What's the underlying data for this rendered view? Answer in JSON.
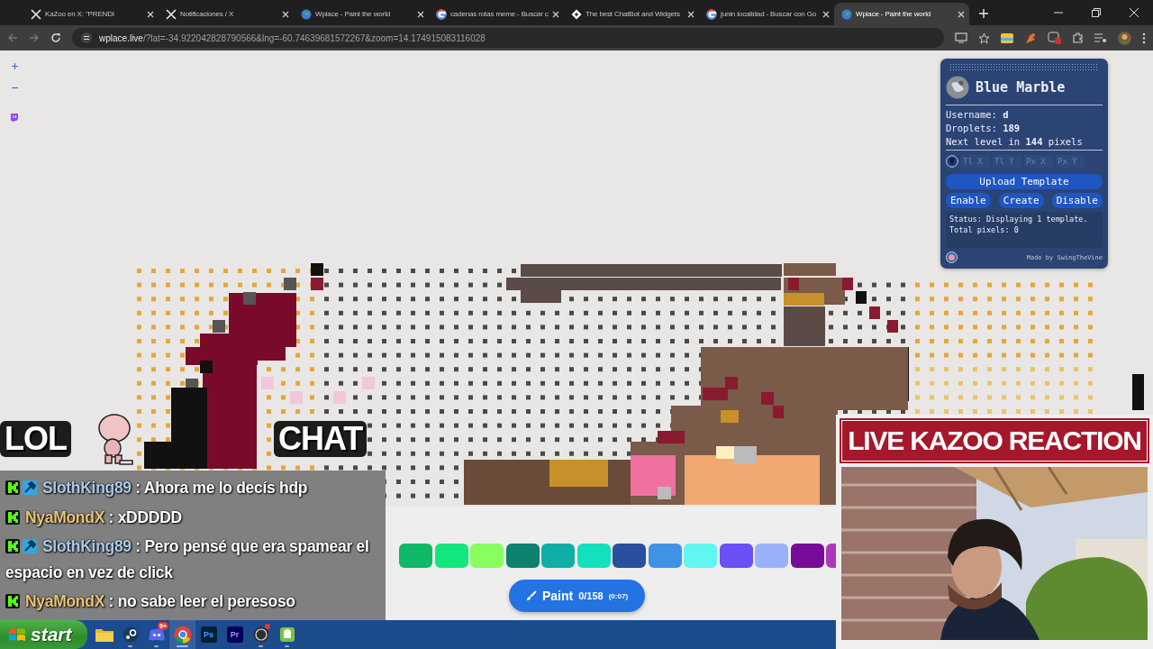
{
  "browser": {
    "tabs": [
      {
        "kind": "x",
        "title": "KaZoo en X: \"PRENDI",
        "selected": false
      },
      {
        "kind": "x",
        "title": "Notificaciones / X",
        "selected": false
      },
      {
        "kind": "globe",
        "title": "Wplace - Paint the world",
        "selected": false
      },
      {
        "kind": "google",
        "title": "cadenas rotas meme - Buscar c",
        "selected": false
      },
      {
        "kind": "bot",
        "title": "The best ChatBot and Widgets",
        "selected": false
      },
      {
        "kind": "google",
        "title": "junin localidad - Buscar con Go",
        "selected": false
      },
      {
        "kind": "globe",
        "title": "Wplace - Paint the world",
        "selected": true
      }
    ],
    "address": {
      "host": "wplace.live",
      "path": "/?lat=-34.922042828790566&lng=-60.74639681572267&zoom=14.174915083116028"
    }
  },
  "panel": {
    "title": "Blue Marble",
    "info": [
      "Username: **d**",
      "Droplets: **189**",
      "Next level in **144** pixels"
    ],
    "coords": [
      {
        "placeholder": "Tl X"
      },
      {
        "placeholder": "Tl Y"
      },
      {
        "placeholder": "Px X"
      },
      {
        "placeholder": "Px Y"
      }
    ],
    "upload": "Upload Template",
    "actions": [
      "Enable",
      "Create",
      "Disable"
    ],
    "status": "Status: Displaying 1 template.\nTotal pixels: 0",
    "footer": "Made by SwingTheVine"
  },
  "palette": {
    "colors": [
      {
        "color": "#0eb968"
      },
      {
        "color": "#13e67b"
      },
      {
        "color": "#87ff5e"
      },
      {
        "color": "#0c816e"
      },
      {
        "color": "#10aea6"
      },
      {
        "color": "#13e1be"
      },
      {
        "color": "#28509e"
      },
      {
        "color": "#4093e4"
      },
      {
        "color": "#60f7f2"
      },
      {
        "color": "#6b50f6"
      },
      {
        "color": "#99b1fb"
      },
      {
        "color": "#780c99"
      },
      {
        "color": "#aa38b9"
      }
    ]
  },
  "paint_button": {
    "label": "Paint",
    "count": "0/158",
    "timer": "(0:07)"
  },
  "overlay": {
    "left_caption": "LOL",
    "right_caption": "CHAT",
    "banner": "LIVE KAZOO REACTION",
    "chat": [
      {
        "badges": [
          {
            "kind": "kick"
          },
          {
            "kind": "mod"
          }
        ],
        "user": "SlothKing89",
        "color": "#aac8ea",
        "text": ": Ahora me lo decís hdp"
      },
      {
        "badges": [
          {
            "kind": "kick"
          }
        ],
        "user": "NyaMondX",
        "color": "#e8c474",
        "text": ": xDDDDD"
      },
      {
        "badges": [
          {
            "kind": "kick"
          },
          {
            "kind": "mod"
          }
        ],
        "user": "SlothKing89",
        "color": "#aac8ea",
        "text": ": Pero pensé que era spamear el espacio en vez de click"
      },
      {
        "badges": [
          {
            "kind": "kick"
          }
        ],
        "user": "NyaMondX",
        "color": "#e8c474",
        "text": ": no sabe leer el peresoso"
      }
    ]
  },
  "taskbar": {
    "start": "start",
    "apps": [
      {
        "kind": "folder",
        "running": false,
        "active": false,
        "alert": false
      },
      {
        "kind": "steam",
        "running": true,
        "active": false,
        "alert": false
      },
      {
        "kind": "discord",
        "badge": "9+",
        "running": true,
        "active": false,
        "alert": false
      },
      {
        "kind": "chrome",
        "running": true,
        "active": true,
        "alert": false
      },
      {
        "kind": "ps",
        "label": "Ps",
        "running": false,
        "active": false,
        "alert": false
      },
      {
        "kind": "pr",
        "label": "Pr",
        "running": false,
        "active": false,
        "alert": false
      },
      {
        "kind": "obs",
        "running": true,
        "active": false,
        "alert": true
      },
      {
        "kind": "android",
        "running": true,
        "active": false,
        "alert": false
      }
    ]
  }
}
